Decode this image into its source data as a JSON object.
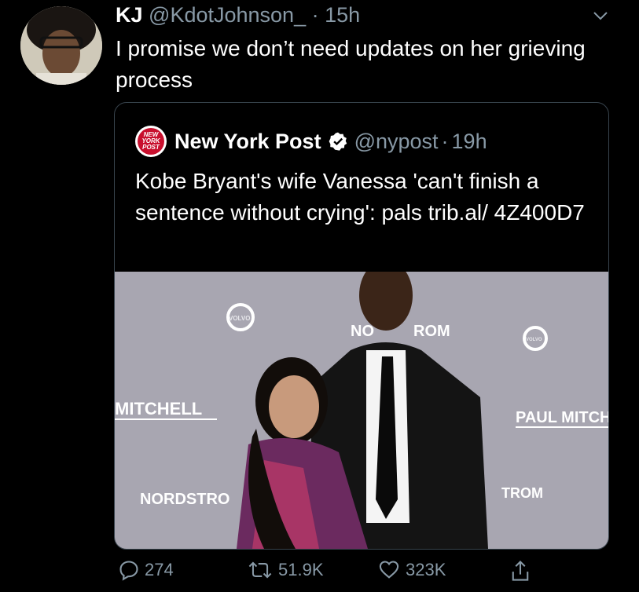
{
  "tweet": {
    "author_name": "KJ",
    "author_handle": "@KdotJohnson_",
    "separator": "·",
    "time": "15h",
    "text": "I promise we don’t need updates on her grieving process"
  },
  "quote": {
    "author_name": "New York Post",
    "author_handle": "@nypost",
    "separator": "·",
    "time": "19h",
    "text": "Kobe Bryant's wife Vanessa 'can't finish a sentence without crying': pals trib.al/ 4Z400D7",
    "logo_text": [
      "NEW",
      "YORK",
      "POST"
    ],
    "photo": {
      "backdrop_texts": [
        "VOLVO",
        "NO",
        "ROM",
        "VOLVO",
        "MITCHELL",
        "PAUL MITCH",
        "NORDSTRO",
        "TROM"
      ]
    }
  },
  "actions": {
    "replies": "274",
    "retweets": "51.9K",
    "likes": "323K"
  },
  "icons": [
    "chevron-down-icon",
    "verified-icon",
    "reply-icon",
    "retweet-icon",
    "like-icon",
    "share-icon"
  ],
  "colors": {
    "background": "#000000",
    "muted": "#8899a6",
    "border": "#38444d",
    "verified": "#ffffff",
    "nypost_red": "#c8102e"
  }
}
